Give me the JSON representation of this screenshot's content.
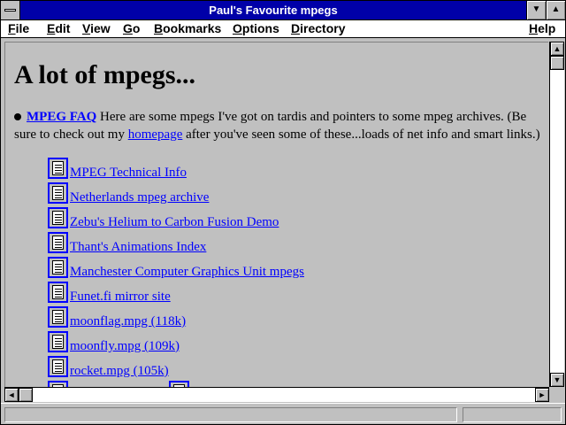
{
  "window": {
    "title": "Paul's Favourite mpegs",
    "min_symbol": "▼",
    "max_symbol": "▲"
  },
  "menu": {
    "file": "File",
    "edit": "Edit",
    "view": "View",
    "go": "Go",
    "bookmarks": "Bookmarks",
    "options": "Options",
    "directory": "Directory",
    "help": "Help"
  },
  "page": {
    "heading": "A lot of mpegs...",
    "faq_link": "MPEG FAQ",
    "intro_text": " Here are some mpegs I've got on tardis and pointers to some mpeg archives. (Be sure to check out my ",
    "homepage_link": "homepage",
    "intro_tail": " after you've seen some of these...loads of net info and smart links.)",
    "links": [
      {
        "label": "MPEG Technical Info",
        "icon": "document-icon"
      },
      {
        "label": " Netherlands mpeg archive",
        "icon": "document-icon"
      },
      {
        "label": "Zebu's Helium to Carbon Fusion Demo",
        "icon": "document-icon"
      },
      {
        "label": "Thant's Animations Index",
        "icon": "document-icon"
      },
      {
        "label": " Manchester Computer Graphics Unit mpegs",
        "icon": "document-icon"
      },
      {
        "label": " Funet.fi mirror site",
        "icon": "document-icon"
      },
      {
        "label": " moonflag.mpg (118k)",
        "icon": "document-icon"
      },
      {
        "label": " moonfly.mpg (109k)",
        "icon": "document-icon"
      },
      {
        "label": " rocket.mpg (105k)",
        "icon": "document-icon"
      }
    ]
  },
  "scroll": {
    "up": "▲",
    "down": "▼",
    "left": "◄",
    "right": "►"
  },
  "status": {
    "text": ""
  },
  "colors": {
    "titlebar": "#0000a8",
    "link": "#0000ff",
    "background": "#c0c0c0"
  }
}
